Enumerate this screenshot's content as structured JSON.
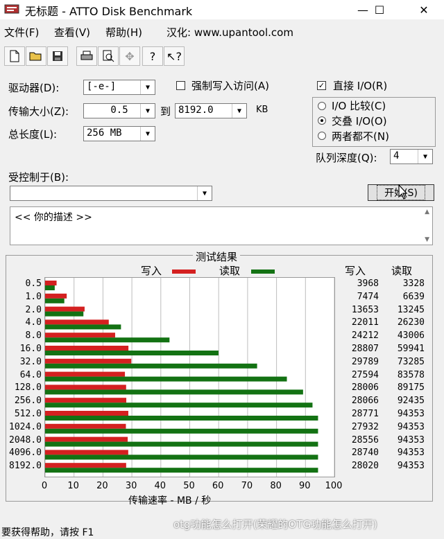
{
  "window": {
    "title": "无标题 - ATTO Disk Benchmark",
    "min": "—",
    "max": "☐",
    "close": "✕"
  },
  "menu": [
    "文件(F)",
    "查看(V)",
    "帮助(H)",
    "汉化: www.upantool.com"
  ],
  "toolbar_icons": [
    "new-icon",
    "open-icon",
    "save-icon",
    "print-icon",
    "print-preview-icon",
    "move-icon",
    "help-icon",
    "context-help-icon"
  ],
  "form": {
    "drive_label": "驱动器(D):",
    "drive_value": "[-e-]",
    "force_write_label": "强制写入访问(A)",
    "transfer_label": "传输大小(Z):",
    "transfer_from": "0.5",
    "to_label": "到",
    "transfer_to": "8192.0",
    "kb_label": "KB",
    "total_label": "总长度(L):",
    "total_value": "256 MB",
    "direct_io_label": "直接 I/O(R)",
    "io_compare": "I/O 比较(C)",
    "overlap_io": "交叠 I/O(O)",
    "neither": "两者都不(N)",
    "queue_label": "队列深度(Q):",
    "queue_value": "4",
    "controlled_label": "受控制于(B):",
    "start_button": "开始(S)",
    "description": "<<   你的描述   >>"
  },
  "results": {
    "group_title": "测试结果",
    "legend_write": "写入",
    "legend_read": "读取",
    "col_write": "写入",
    "col_read": "读取",
    "xlabel": "传输速率 - MB / 秒",
    "write_values": [
      "3968",
      "7474",
      "13653",
      "22011",
      "24212",
      "28807",
      "29789",
      "27594",
      "28006",
      "28066",
      "28771",
      "27932",
      "28556",
      "28740",
      "28020"
    ],
    "read_values": [
      "3328",
      "6639",
      "13245",
      "26230",
      "43006",
      "59941",
      "73285",
      "83578",
      "89175",
      "92435",
      "94353",
      "94353",
      "94353",
      "94353",
      "94353"
    ]
  },
  "chart_data": {
    "type": "bar",
    "categories": [
      "0.5",
      "1.0",
      "2.0",
      "4.0",
      "8.0",
      "16.0",
      "32.0",
      "64.0",
      "128.0",
      "256.0",
      "512.0",
      "1024.0",
      "2048.0",
      "4096.0",
      "8192.0"
    ],
    "series": [
      {
        "name": "写入",
        "color": "#d42020",
        "values": [
          3.968,
          7.474,
          13.653,
          22.011,
          24.212,
          28.807,
          29.789,
          27.594,
          28.006,
          28.066,
          28.771,
          27.932,
          28.556,
          28.74,
          28.02
        ]
      },
      {
        "name": "读取",
        "color": "#137213",
        "values": [
          3.328,
          6.639,
          13.245,
          26.23,
          43.006,
          59.941,
          73.285,
          83.578,
          89.175,
          92.435,
          94.353,
          94.353,
          94.353,
          94.353,
          94.353
        ]
      }
    ],
    "xticks": [
      "0",
      "10",
      "20",
      "30",
      "40",
      "50",
      "60",
      "70",
      "80",
      "90",
      "100"
    ],
    "xlabel": "传输速率 - MB / 秒",
    "xlim": [
      0,
      100
    ],
    "grid": true,
    "legend": "top"
  },
  "status": {
    "text": "要获得帮助，请按 F1"
  },
  "caption": "otg功能怎么打开(荣耀的OTG功能怎么打开)"
}
